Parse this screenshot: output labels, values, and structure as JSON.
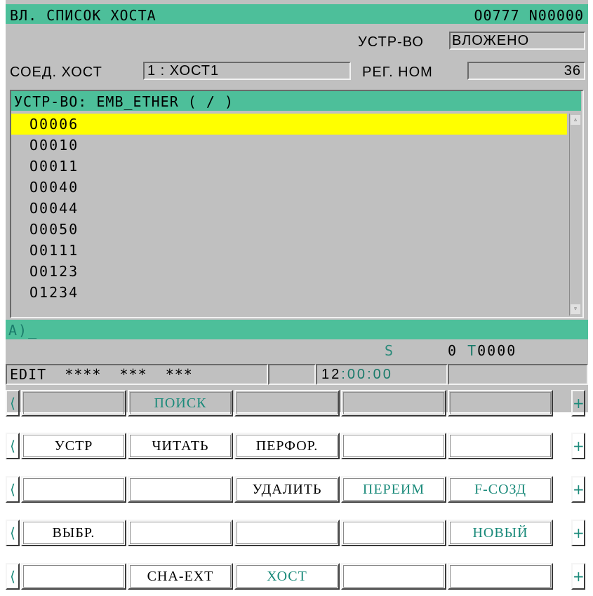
{
  "header": {
    "title": "ВЛ. СПИСОК ХОСТА",
    "program": "O0777 N00000"
  },
  "device": {
    "label": "УСТР-ВО",
    "value": "ВЛОЖЕНО"
  },
  "connection": {
    "label": "СОЕД. ХОСТ",
    "value": "1  :  ХОСТ1",
    "reg_label": "РЕГ. НОМ",
    "reg_value": "36"
  },
  "panel": {
    "header": "УСТР-ВО:  EMB_ETHER  ( / )",
    "files": [
      "O0006",
      "O0010",
      "O0011",
      "O0040",
      "O0044",
      "O0050",
      "O0111",
      "O0123",
      "O1234"
    ]
  },
  "input": {
    "prompt": "A)_"
  },
  "status": {
    "s_label": "S",
    "s_value": "0",
    "t_label": "T",
    "t_value": "0000"
  },
  "mode": {
    "text": "EDIT  ****  ***  ***",
    "clock_h": "12",
    "clock_m": "00",
    "clock_s": "00"
  },
  "softkeys": {
    "row1": [
      "",
      "ПОИСК",
      "",
      "",
      ""
    ],
    "row2": [
      "УСТР",
      "ЧИТАТЬ",
      "ПЕРФОР.",
      "",
      ""
    ],
    "row3": [
      "",
      "",
      "УДАЛИТЬ",
      "ПЕРЕИМ",
      "F-СОЗД"
    ],
    "row4": [
      "ВЫБР.",
      "",
      "",
      "",
      "НОВЫЙ"
    ],
    "row5": [
      "",
      "CHA-EXT",
      "ХОСТ",
      "",
      ""
    ]
  },
  "colors": {
    "accent": "#4dbf9a",
    "selection": "#ffff00",
    "screen": "#c0c0c0"
  }
}
